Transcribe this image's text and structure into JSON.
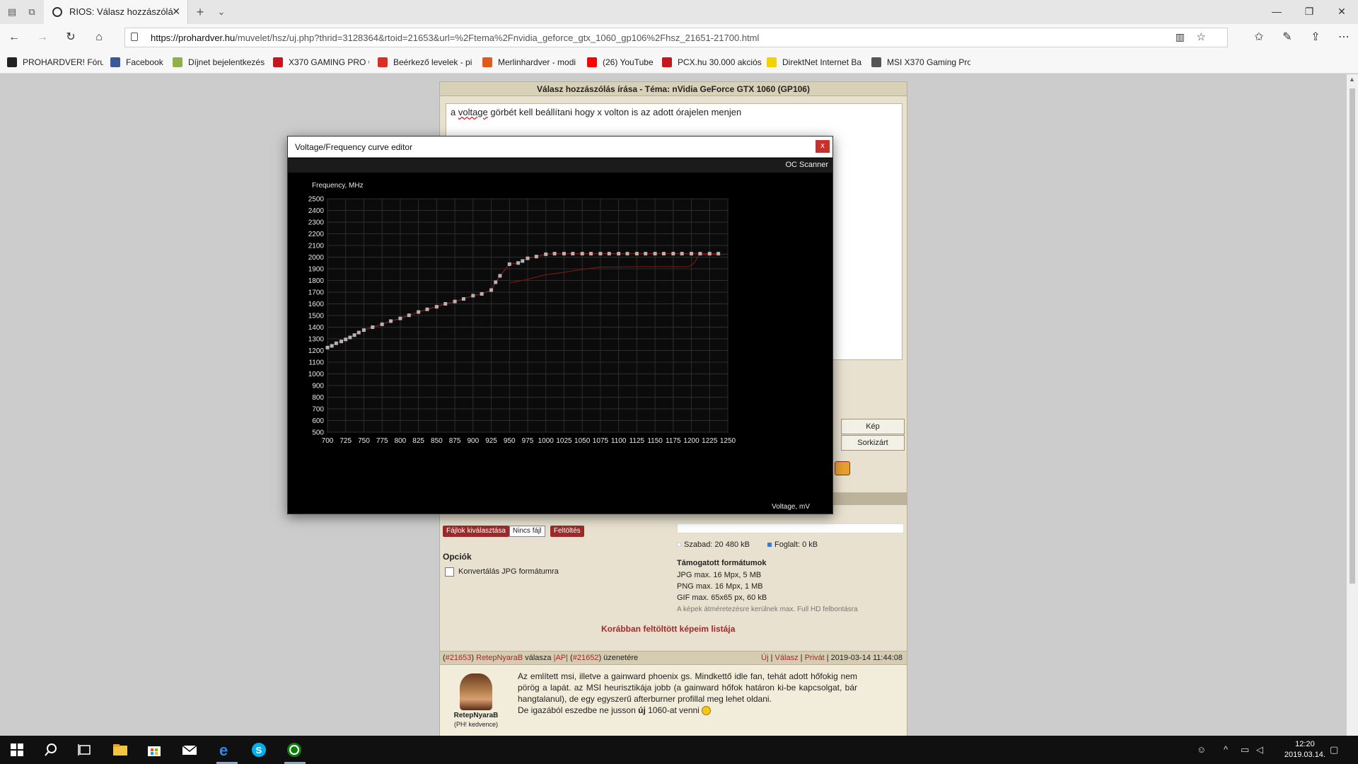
{
  "browser": {
    "tab_title": "RIOS: Válasz hozzászólá",
    "url_host": "https://prohardver.hu",
    "url_path": "/muvelet/hsz/uj.php?thrid=3128364&rtoid=21653&url=%2Ftema%2Fnvidia_geforce_gtx_1060_gp106%2Fhsz_21651-21700.html",
    "favorites": [
      {
        "label": "PROHARDVER! Fórun",
        "color": "#222222"
      },
      {
        "label": "Facebook",
        "color": "#3b5998"
      },
      {
        "label": "Díjnet bejelentkezés",
        "color": "#8fb04a"
      },
      {
        "label": "X370 GAMING PRO C",
        "color": "#c4161c"
      },
      {
        "label": "Beérkező levelek - pi",
        "color": "#d93025"
      },
      {
        "label": "Merlinhardver - modi",
        "color": "#e05a1a"
      },
      {
        "label": "(26) YouTube",
        "color": "#ff0000"
      },
      {
        "label": "PCX.hu 30.000 akciós",
        "color": "#c4161c"
      },
      {
        "label": "DirektNet Internet Ba",
        "color": "#f2d200"
      },
      {
        "label": "MSI X370 Gaming Pro",
        "color": "#555555"
      }
    ]
  },
  "page": {
    "header": "Válasz hozzászólás írása - Téma: nVidia GeForce GTX 1060 (GP106)",
    "reply_prefix": "a ",
    "reply_misspelled": "voltage",
    "reply_rest": " görbét kell beállítani hogy x volton is az adott órajelen menjen",
    "btn_kep": "Kép",
    "btn_sorkizart": "Sorkizárt",
    "upload": {
      "choose": "Fájlok kiválasztása",
      "no_file": "Nincs fájl",
      "upload": "Feltöltés"
    },
    "quota": {
      "free": "Szabad: 20 480 kB",
      "used": "Foglalt: 0 kB"
    },
    "options_title": "Opciók",
    "convert_jpg": "Konvertálás JPG formátumra",
    "formats_title": "Támogatott formátumok",
    "formats": [
      "JPG max. 16 Mpx, 5 MB",
      "PNG max. 16 Mpx, 1 MB",
      "GIF max. 65x65 px, 60 kB"
    ],
    "resize_note": "A képek átméretezésre kerülnek max. Full HD felbontásra",
    "prev_images": "Korábban feltöltött képeim listája",
    "post": {
      "num": "#21653",
      "author": "RetepNyaraB",
      "valasza": "válasza",
      "ap": "|AP|",
      "reply_to": "#21652",
      "uzenetere": "üzenetére",
      "actions": [
        "Új",
        "Válasz",
        "Privát"
      ],
      "date": "2019-03-14 11:44:08",
      "avatar_name": "RetepNyaraB",
      "avatar_rank": "(PH! kedvence)",
      "body": "Az említett msi, illetve a gainward phoenix gs. Mindkettő idle fan, tehát adott hőfokig nem pörög a lapát. az MSI heurisztikája jobb (a gainward hőfok határon ki-be kapcsolgat, bár hangtalanul), de egy egyszerű afterburner profillal meg lehet oldani.",
      "body2_a": "De igazából eszedbe ne jusson ",
      "body2_b": "új",
      "body2_c": " 1060-at venni"
    }
  },
  "dialog": {
    "title": "Voltage/Frequency curve editor",
    "close": "x",
    "oc_scanner": "OC Scanner"
  },
  "chart_data": {
    "type": "line",
    "ylabel": "Frequency, MHz",
    "xlabel": "Voltage, mV",
    "xlim": [
      700,
      1250
    ],
    "ylim": [
      500,
      2500
    ],
    "x_ticks": [
      700,
      725,
      750,
      775,
      800,
      825,
      850,
      875,
      900,
      925,
      950,
      975,
      1000,
      1025,
      1050,
      1075,
      1100,
      1125,
      1150,
      1175,
      1200,
      1225,
      1250
    ],
    "y_ticks": [
      500,
      600,
      700,
      800,
      900,
      1000,
      1100,
      1200,
      1300,
      1400,
      1500,
      1600,
      1700,
      1800,
      1900,
      2000,
      2100,
      2200,
      2300,
      2400,
      2500
    ],
    "grid": true,
    "series": [
      {
        "color": "#b3b3b3",
        "x": [
          700,
          706,
          712,
          719,
          725,
          731,
          737,
          743,
          750,
          762,
          775,
          787,
          800,
          812,
          825,
          837,
          850,
          862,
          875,
          887,
          900,
          912,
          925,
          931,
          937,
          950,
          962,
          968,
          975,
          987,
          1000,
          1012,
          1025,
          1037,
          1050,
          1062,
          1075,
          1087,
          1100,
          1112,
          1125,
          1137,
          1150,
          1162,
          1175,
          1187,
          1200,
          1212,
          1225,
          1237
        ],
        "y": [
          1225,
          1240,
          1262,
          1278,
          1295,
          1312,
          1332,
          1354,
          1375,
          1400,
          1425,
          1452,
          1475,
          1502,
          1530,
          1553,
          1575,
          1600,
          1620,
          1642,
          1670,
          1685,
          1718,
          1785,
          1840,
          1940,
          1950,
          1967,
          1990,
          2005,
          2025,
          2030,
          2030,
          2030,
          2030,
          2030,
          2030,
          2030,
          2030,
          2030,
          2030,
          2030,
          2030,
          2030,
          2030,
          2030,
          2030,
          2030,
          2030,
          2030
        ]
      },
      {
        "color": "#7a1414",
        "x": [
          950,
          960,
          975,
          1000,
          1025,
          1050,
          1075,
          1100,
          1125,
          1150,
          1175,
          1195,
          1200,
          1205,
          1210,
          1250
        ],
        "y": [
          1780,
          1790,
          1810,
          1850,
          1870,
          1895,
          1915,
          1915,
          1918,
          1918,
          1918,
          1918,
          1930,
          1960,
          2020,
          2025
        ]
      }
    ]
  },
  "taskbar": {
    "time": "12:20",
    "date": "2019.03.14."
  }
}
